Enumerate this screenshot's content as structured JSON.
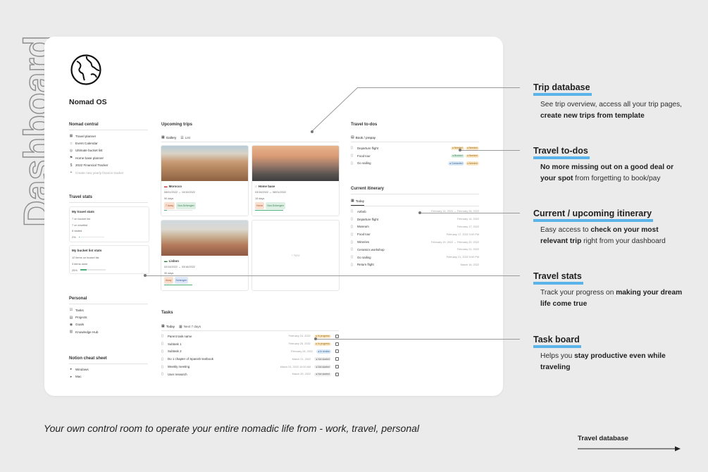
{
  "side_title": "Dashboard",
  "app": {
    "title": "Nomad OS",
    "logo": "globe-icon"
  },
  "nomad_central": {
    "heading": "Nomad central",
    "items": [
      {
        "icon": "calendar-icon",
        "label": "Travel planner"
      },
      {
        "icon": "star-icon",
        "label": "Event Calendar"
      },
      {
        "icon": "check-circle-icon",
        "label": "Ultimate bucket list"
      },
      {
        "icon": "flag-icon",
        "label": "Home base planner"
      },
      {
        "icon": "dollar-icon",
        "label": "2022 Financial Tracker"
      },
      {
        "icon": "plus-icon",
        "label": "Create new yearly finance tracker"
      }
    ]
  },
  "travel_stats": {
    "heading": "Travel stats",
    "cards": [
      {
        "title": "My travel stats",
        "lines": [
          "7 on bucket list",
          "7 on shortlist",
          "5 visited"
        ],
        "bar_label": "2%",
        "bar_fraction": 0.02
      },
      {
        "title": "My bucket list stats",
        "lines": [
          "12 items on bucket list",
          "3 items done"
        ],
        "bar_label": "25%",
        "bar_fraction": 0.25
      }
    ]
  },
  "personal": {
    "heading": "Personal",
    "items": [
      {
        "icon": "check-square-icon",
        "label": "Tasks"
      },
      {
        "icon": "clipboard-icon",
        "label": "Projects"
      },
      {
        "icon": "target-icon",
        "label": "Goals"
      },
      {
        "icon": "book-icon",
        "label": "Knowledge Hub"
      }
    ]
  },
  "cheat_sheet": {
    "heading": "Notion cheat sheet",
    "items": [
      {
        "label": "Windows"
      },
      {
        "label": "Mac"
      }
    ]
  },
  "upcoming_trips": {
    "heading": "Upcoming trips",
    "tabs": [
      {
        "icon": "gallery-icon",
        "label": "Gallery"
      },
      {
        "icon": "list-icon",
        "label": "List"
      }
    ],
    "trips": [
      {
        "name": "Morocco",
        "flag": "flag-morocco",
        "dates": "08/01/2022 → 10/10/2022",
        "days": "90 days",
        "tags": [
          {
            "text": "7 Away",
            "bg": "#f9dfcf",
            "fg": "#b0552b"
          },
          {
            "text": "Non-Schengen",
            "bg": "#dcefe2",
            "fg": "#3b7d55"
          }
        ],
        "progress": 0.1
      },
      {
        "name": "Home base",
        "flag": "house-icon",
        "dates": "03/16/2022 → 08/01/2022",
        "days": "15 days",
        "tags": [
          {
            "text": "Home",
            "bg": "#f9dfcf",
            "fg": "#b0552b"
          },
          {
            "text": "Non-Schengen",
            "bg": "#dcefe2",
            "fg": "#3b7d55"
          }
        ],
        "progress": 1.0
      },
      {
        "name": "Lisbon",
        "flag": "flag-portugal",
        "dates": "02/14/2022 → 03/16/2022",
        "days": "30 days",
        "tags": [
          {
            "text": "Away",
            "bg": "#f9dfcf",
            "fg": "#b0552b"
          },
          {
            "text": "Schengen",
            "bg": "#dde7f7",
            "fg": "#3a5f98"
          }
        ],
        "progress": 1.0
      }
    ],
    "new_label": "+ New"
  },
  "tasks": {
    "heading": "Tasks",
    "tabs": [
      {
        "icon": "calendar-icon",
        "label": "Today"
      },
      {
        "icon": "calendar-icon",
        "label": "Next 7 days"
      }
    ],
    "rows": [
      {
        "name": "Parent task name",
        "date": "February 24, 2022",
        "status": "In progress",
        "bg": "#fae7c5",
        "fg": "#9a6a15"
      },
      {
        "name": "Subtask 1",
        "date": "February 25, 2022",
        "status": "In progress",
        "bg": "#fae7c5",
        "fg": "#9a6a15"
      },
      {
        "name": "Subtask 2",
        "date": "February 28, 2022",
        "status": "In review",
        "bg": "#d9e8f6",
        "fg": "#386690"
      },
      {
        "name": "Do 1 chapter of Spanish textbook",
        "date": "March 21, 2022",
        "status": "Not started",
        "bg": "#ececec",
        "fg": "#666666"
      },
      {
        "name": "Weekly meeting",
        "date": "March 24, 2022 10:00 AM",
        "status": "Not started",
        "bg": "#ececec",
        "fg": "#666666"
      },
      {
        "name": "User research",
        "date": "March 25, 2022",
        "status": "Not started",
        "bg": "#ececec",
        "fg": "#666666"
      }
    ]
  },
  "travel_todos": {
    "heading": "Travel to-dos",
    "tab": "Book / prepay",
    "rows": [
      {
        "name": "Departure flight",
        "s1": "Needed",
        "s1bg": "#fae7c5",
        "s1fg": "#9a6a15",
        "s2": "Needed",
        "s2bg": "#fae7c5",
        "s2fg": "#9a6a15"
      },
      {
        "name": "Food tour",
        "s1": "Booked",
        "s1bg": "#dcefe2",
        "s1fg": "#3b7d55",
        "s2": "Needed",
        "s2bg": "#fae7c5",
        "s2fg": "#9a6a15"
      },
      {
        "name": "Go sailing",
        "s1": "Contacted",
        "s1bg": "#d9e8f6",
        "s1fg": "#386690",
        "s2": "Needed",
        "s2bg": "#fae7c5",
        "s2fg": "#9a6a15"
      }
    ]
  },
  "itinerary": {
    "heading": "Current itinerary",
    "tab": "Today",
    "rows": [
      {
        "name": "Airbnb",
        "date": "February 14, 2022 → February 28, 2022"
      },
      {
        "name": "Departure flight",
        "date": "February 14, 2022"
      },
      {
        "name": "Museum",
        "date": "February 17, 2022"
      },
      {
        "name": "Food tour",
        "date": "February 17, 2022 3:00 PM"
      },
      {
        "name": "Wineries",
        "date": "February 19, 2022 → February 20, 2022"
      },
      {
        "name": "Ceramics workshop",
        "date": "February 21, 2022"
      },
      {
        "name": "Go sailing",
        "date": "February 21, 2022 5:00 PM"
      },
      {
        "name": "Return flight",
        "date": "March 16, 2022"
      }
    ]
  },
  "annotations": [
    {
      "title": "Trip database",
      "text_parts": [
        {
          "t": "See trip overview, access all your trip pages, "
        },
        {
          "t": "create new trips from template",
          "b": true
        }
      ]
    },
    {
      "title": "Travel to-dos",
      "text_parts": [
        {
          "t": "No more missing out on a good deal or your spot",
          "b": true
        },
        {
          "t": " from forgetting to book/pay"
        }
      ]
    },
    {
      "title": "Current / upcoming itinerary",
      "text_parts": [
        {
          "t": "Easy access to "
        },
        {
          "t": "check on your most relevant trip",
          "b": true
        },
        {
          "t": " right from your dashboard"
        }
      ]
    },
    {
      "title": "Travel stats",
      "text_parts": [
        {
          "t": "Track your progress on "
        },
        {
          "t": "making your dream life come true",
          "b": true
        }
      ]
    },
    {
      "title": "Task board",
      "text_parts": [
        {
          "t": "Helps you "
        },
        {
          "t": "stay productive even while traveling",
          "b": true
        }
      ]
    }
  ],
  "footer": {
    "tagline": "Your own control room to operate your entire nomadic life from - work, travel, personal",
    "link": "Travel database"
  },
  "colors": {
    "accent_underline": "#5ab4ea",
    "background": "#ebebec"
  }
}
